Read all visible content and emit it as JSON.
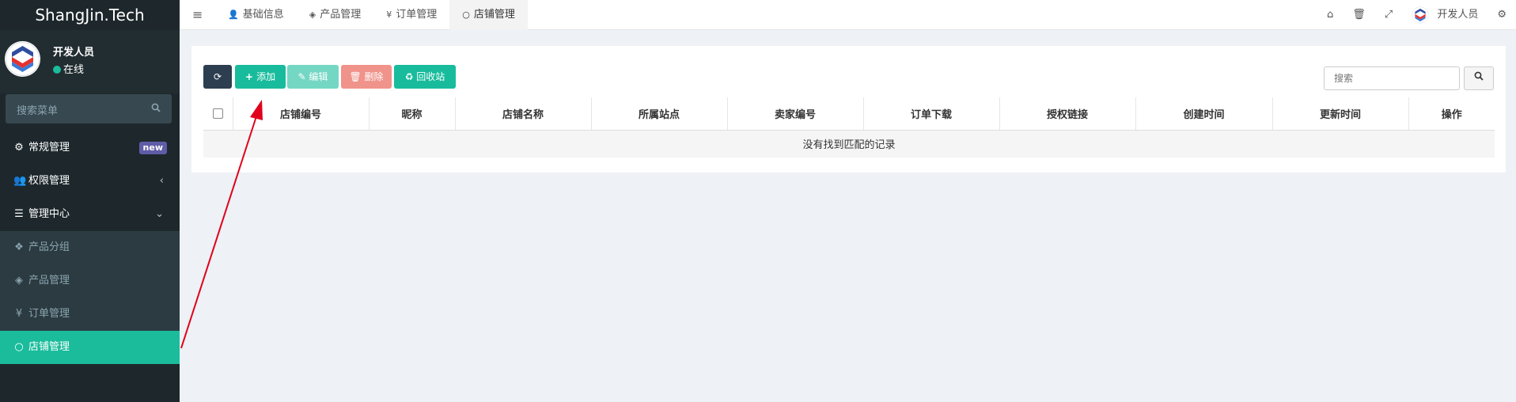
{
  "brand": {
    "title": "ShangJin.Tech"
  },
  "user": {
    "name": "开发人员",
    "status": "在线"
  },
  "sidebar": {
    "search_placeholder": "搜索菜单",
    "items": [
      {
        "label": "常规管理",
        "icon": "cogs-icon",
        "badge": "new"
      },
      {
        "label": "权限管理",
        "icon": "users-icon",
        "chevron": "‹"
      },
      {
        "label": "管理中心",
        "icon": "list-icon",
        "chevron": "⌄"
      },
      {
        "label": "产品分组",
        "icon": "cubes-icon"
      },
      {
        "label": "产品管理",
        "icon": "cube-icon"
      },
      {
        "label": "订单管理",
        "icon": "yen-icon"
      },
      {
        "label": "店铺管理",
        "icon": "circle-icon"
      }
    ]
  },
  "topbar": {
    "tabs": [
      {
        "label": "基础信息",
        "icon": "user-icon"
      },
      {
        "label": "产品管理",
        "icon": "cube-icon"
      },
      {
        "label": "订单管理",
        "icon": "yen-icon"
      },
      {
        "label": "店铺管理",
        "icon": "circle-icon"
      }
    ],
    "user_name": "开发人员"
  },
  "toolbar": {
    "add": "添加",
    "edit": "编辑",
    "delete": "删除",
    "recycle": "回收站",
    "search_placeholder": "搜索"
  },
  "table": {
    "columns": [
      "店铺编号",
      "昵称",
      "店铺名称",
      "所属站点",
      "卖家编号",
      "订单下载",
      "授权链接",
      "创建时间",
      "更新时间",
      "操作"
    ],
    "empty_text": "没有找到匹配的记录"
  },
  "colors": {
    "sidebar_bg": "#222d32",
    "accent": "#1abc9c",
    "annotation_arrow": "#e0001b"
  }
}
